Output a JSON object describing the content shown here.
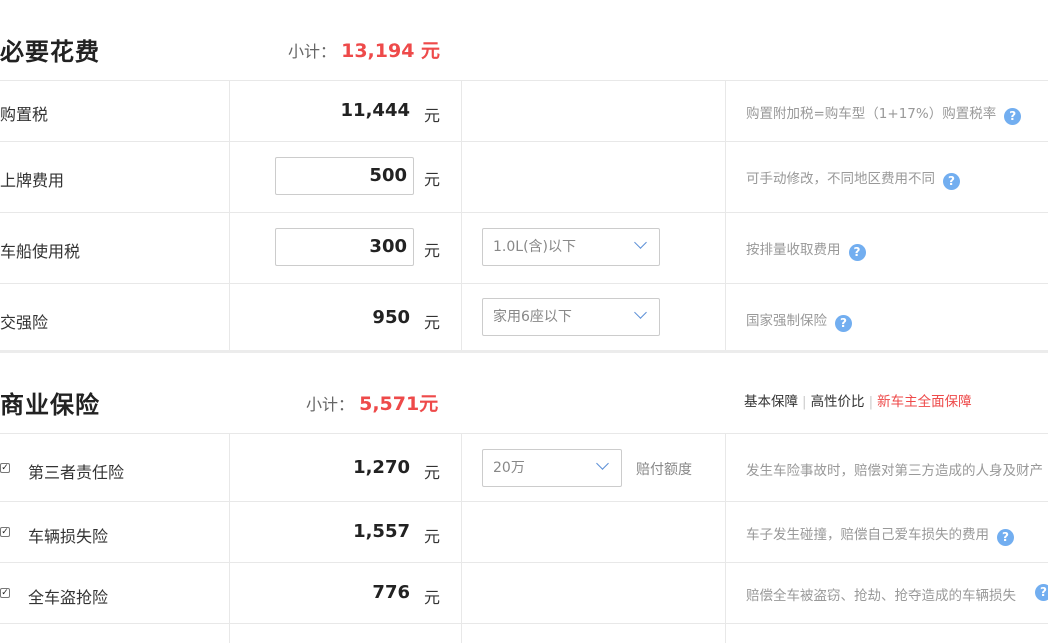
{
  "required": {
    "title": "必要花费",
    "subtotal_label": "小计：",
    "subtotal_value": "13,194 元",
    "rows": [
      {
        "label": "购置税",
        "value": "11,444",
        "unit": "元",
        "note": "购置附加税=购车型（1+17%）购置税率"
      },
      {
        "label": "上牌费用",
        "value": "500",
        "unit": "元",
        "note": "可手动修改，不同地区费用不同"
      },
      {
        "label": "车船使用税",
        "value": "300",
        "unit": "元",
        "select": "1.0L(含)以下",
        "note": "按排量收取费用"
      },
      {
        "label": "交强险",
        "value": "950",
        "unit": "元",
        "select": "家用6座以下",
        "note": "国家强制保险"
      }
    ]
  },
  "commercial": {
    "title": "商业保险",
    "subtotal_label": "小计：",
    "subtotal_value": "5,571元",
    "links": [
      "基本保障",
      "高性价比",
      "新车主全面保障"
    ],
    "rows": [
      {
        "label": "第三者责任险",
        "value": "1,270",
        "unit": "元",
        "select": "20万",
        "select_suffix": "赔付额度",
        "note": "发生车险事故时，赔偿对第三方造成的人身及财产",
        "checked": true
      },
      {
        "label": "车辆损失险",
        "value": "1,557",
        "unit": "元",
        "note": "车子发生碰撞，赔偿自己爱车损失的费用",
        "checked": true
      },
      {
        "label": "全车盗抢险",
        "value": "776",
        "unit": "元",
        "note": "赔偿全车被盗窃、抢劫、抢夺造成的车辆损失",
        "checked": true
      }
    ]
  },
  "icons": {
    "help": "question-circle-icon",
    "check": "checkbox-checked-icon",
    "dropdown": "chevron-down-icon"
  },
  "colors": {
    "accent_red": "#ee4a4a",
    "help_blue": "#72aef0",
    "chevron_blue": "#5b8fd6"
  }
}
